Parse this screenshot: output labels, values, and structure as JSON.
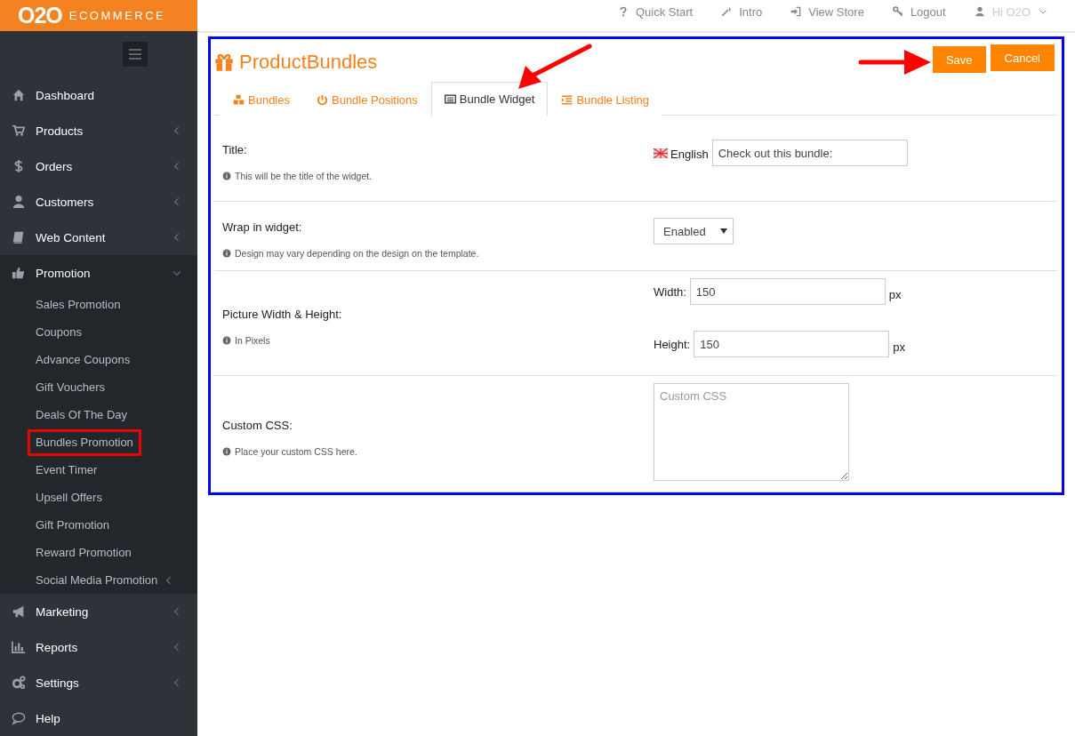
{
  "brand": {
    "logo": "O2O",
    "name": "ECOMMERCE"
  },
  "top_nav": [
    {
      "label": "Quick Start",
      "kind": "link"
    },
    {
      "label": "Intro",
      "kind": "link"
    },
    {
      "label": "View Store",
      "kind": "link"
    },
    {
      "label": "Logout",
      "kind": "link"
    },
    {
      "label": "Hi O2O",
      "kind": "user"
    }
  ],
  "sidebar": {
    "items": [
      {
        "label": "Dashboard",
        "expandable": false,
        "expanded": false
      },
      {
        "label": "Products",
        "expandable": true,
        "expanded": false
      },
      {
        "label": "Orders",
        "expandable": true,
        "expanded": false
      },
      {
        "label": "Customers",
        "expandable": true,
        "expanded": false
      },
      {
        "label": "Web Content",
        "expandable": true,
        "expanded": false
      },
      {
        "label": "Promotion",
        "expandable": true,
        "expanded": true,
        "children": [
          {
            "label": "Sales Promotion",
            "expandable": false,
            "highlighted": false
          },
          {
            "label": "Coupons",
            "expandable": false,
            "highlighted": false
          },
          {
            "label": "Advance Coupons",
            "expandable": false,
            "highlighted": false
          },
          {
            "label": "Gift Vouchers",
            "expandable": false,
            "highlighted": false
          },
          {
            "label": "Deals Of The Day",
            "expandable": false,
            "highlighted": false
          },
          {
            "label": "Bundles Promotion",
            "expandable": false,
            "highlighted": true
          },
          {
            "label": "Event Timer",
            "expandable": false,
            "highlighted": false
          },
          {
            "label": "Upsell Offers",
            "expandable": false,
            "highlighted": false
          },
          {
            "label": "Gift Promotion",
            "expandable": false,
            "highlighted": false
          },
          {
            "label": "Reward Promotion",
            "expandable": false,
            "highlighted": false
          },
          {
            "label": "Social Media Promotion",
            "expandable": true,
            "highlighted": false
          }
        ]
      },
      {
        "label": "Marketing",
        "expandable": true,
        "expanded": false
      },
      {
        "label": "Reports",
        "expandable": true,
        "expanded": false
      },
      {
        "label": "Settings",
        "expandable": true,
        "expanded": false
      },
      {
        "label": "Help",
        "expandable": false,
        "expanded": false
      }
    ]
  },
  "panel": {
    "framed": true,
    "title": "ProductBundles",
    "buttons": [
      {
        "label": "Save",
        "pointed": true
      },
      {
        "label": "Cancel"
      }
    ],
    "tabs": [
      {
        "label": "Bundles",
        "selected": false,
        "pointed": false
      },
      {
        "label": "Bundle Positions",
        "selected": false,
        "pointed": false
      },
      {
        "label": "Bundle Widget",
        "selected": true,
        "pointed": true
      },
      {
        "label": "Bundle Listing",
        "selected": false,
        "pointed": false
      }
    ],
    "rows": [
      {
        "kind": "text",
        "label": "Title:",
        "help": "This will be the title of the widget.",
        "language": "English",
        "value": "Check out this bundle:"
      },
      {
        "kind": "select",
        "label": "Wrap in widget:",
        "help": "Design may vary depending on the design on the template.",
        "value": "Enabled"
      },
      {
        "kind": "dimensions",
        "label": "Picture Width & Height:",
        "help": "In Pixels",
        "fields": [
          {
            "label": "Width:",
            "value": "150",
            "unit": "px"
          },
          {
            "label": "Height:",
            "value": "150",
            "unit": "px"
          }
        ]
      },
      {
        "kind": "textarea",
        "label": "Custom CSS:",
        "help": "Place your custom CSS here.",
        "placeholder": "Custom CSS"
      }
    ]
  }
}
